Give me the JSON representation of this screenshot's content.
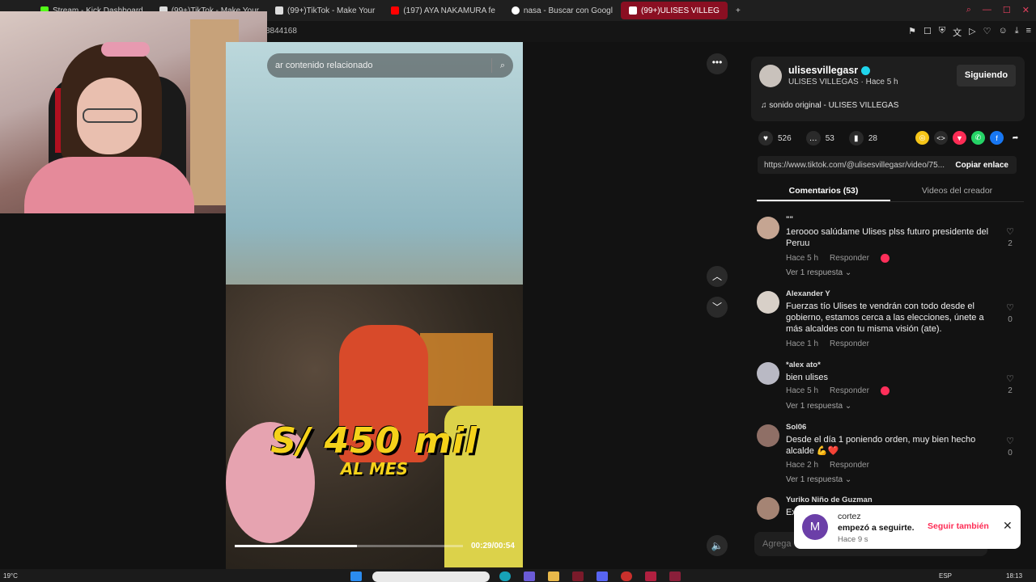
{
  "browser": {
    "tabs": [
      {
        "label": "Stream - Kick Dashboard",
        "active": false,
        "color": "#53fc18"
      },
      {
        "label": "(99+)TikTok - Make Your",
        "active": false,
        "color": "#ffffff"
      },
      {
        "label": "(99+)TikTok - Make Your",
        "active": false,
        "color": "#ffffff"
      },
      {
        "label": "(197) AYA NAKAMURA fe",
        "active": false,
        "color": "#ff0000"
      },
      {
        "label": "nasa - Buscar con Googl",
        "active": false,
        "color": "#ffffff"
      },
      {
        "label": "(99+)ULISES VILLEG",
        "active": true,
        "color": "#ffffff"
      }
    ],
    "new_tab": "+",
    "url_fragment": "8844168"
  },
  "video": {
    "search_placeholder": "ar contenido relacionado",
    "overlay_big": "S/ 450 mil",
    "overlay_small": "AL MES",
    "timecode": "00:29/00:54",
    "progress_fraction": 0.537
  },
  "creator": {
    "username": "ulisesvillegasr",
    "subline": "ULISES VILLEGAS · Hace 5 h",
    "follow_label": "Siguiendo",
    "sound": "sonido original - ULISES VILLEGAS"
  },
  "stats": {
    "likes": "526",
    "comments": "53",
    "saves": "28"
  },
  "link": {
    "url": "https://www.tiktok.com/@ulisesvillegasr/video/75...",
    "copy_label": "Copiar enlace"
  },
  "panel_tabs": {
    "comments": "Comentarios (53)",
    "creator_videos": "Videos del creador"
  },
  "comments": [
    {
      "name": "\"\"",
      "text": "1eroooo salúdame Ulises plss futuro presidente del Peruu",
      "time": "Hace 5 h",
      "reply": "Responder",
      "likes": "2",
      "view_replies": "Ver 1 respuesta ⌄"
    },
    {
      "name": "Alexander Y",
      "text": "Fuerzas tío Ulises te vendrán con todo desde el gobierno, estamos cerca a las elecciones, únete a más alcaldes con tu misma visión (ate).",
      "time": "Hace 1 h",
      "reply": "Responder",
      "likes": "0",
      "view_replies": ""
    },
    {
      "name": "*alex ato*",
      "text": "bien ulises",
      "time": "Hace 5 h",
      "reply": "Responder",
      "likes": "2",
      "view_replies": "Ver 1 respuesta ⌄"
    },
    {
      "name": "Sol06",
      "text": "Desde el día 1 poniendo orden, muy bien hecho alcalde 💪❤️",
      "time": "Hace 2 h",
      "reply": "Responder",
      "likes": "0",
      "view_replies": "Ver 1 respuesta ⌄"
    },
    {
      "name": "Yuriko Niño de Guzman",
      "text": "Ex",
      "time": "",
      "reply": "",
      "likes": "",
      "view_replies": ""
    }
  ],
  "comment_input_placeholder": "Agrega",
  "toast": {
    "avatar_letter": "M",
    "name": "cortez",
    "message": "empezó a seguirte.",
    "time": "Hace 9 s",
    "action": "Seguir también",
    "close": "✕"
  },
  "taskbar": {
    "weather": "19°C",
    "lang": "ESP",
    "time": "18:13"
  }
}
